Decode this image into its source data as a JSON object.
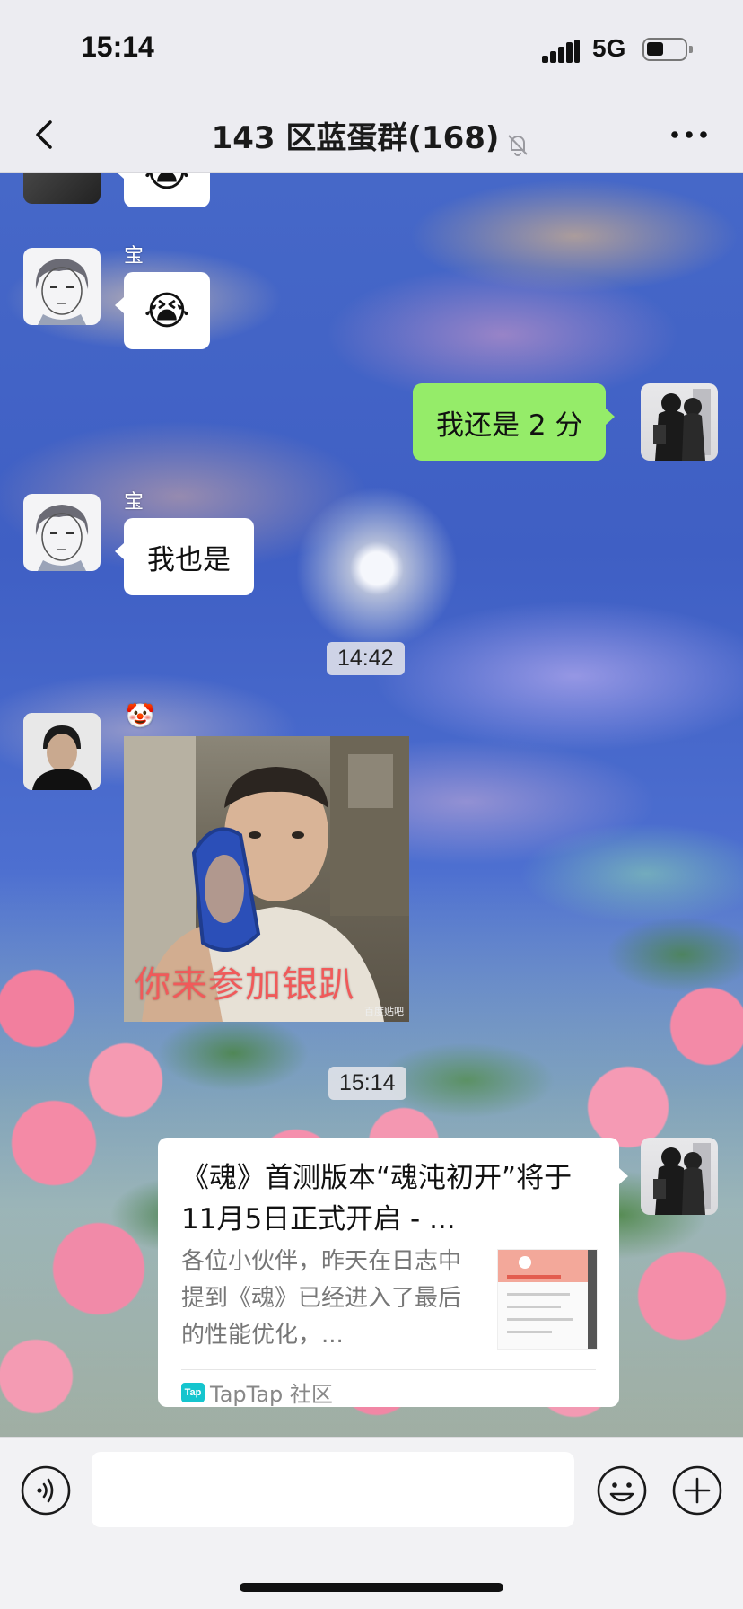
{
  "status_bar": {
    "time": "15:14",
    "network": "5G"
  },
  "nav": {
    "title": "143 区蓝蛋群(168)",
    "back_icon": "chevron-left-icon",
    "mute_icon": "bell-slash-icon",
    "more_icon": "ellipsis-icon"
  },
  "messages": [
    {
      "type": "emoji",
      "side": "left",
      "sender": "",
      "content": "😭"
    },
    {
      "type": "emoji",
      "side": "left",
      "sender": "宝",
      "content": "😭"
    },
    {
      "type": "text",
      "side": "right",
      "content": "我还是 2 分"
    },
    {
      "type": "text",
      "side": "left",
      "sender": "宝",
      "content": "我也是"
    },
    {
      "type": "time",
      "content": "14:42"
    },
    {
      "type": "image",
      "side": "left",
      "sender": "🤡",
      "caption": "你来参加银趴",
      "watermark": "百度贴吧"
    },
    {
      "type": "time",
      "content": "15:14"
    },
    {
      "type": "link_card",
      "side": "right",
      "title": "《魂》首测版本“魂沌初开”将于 11月5日正式开启 - ...",
      "description": "各位小伙伴，昨天在日志中提到《魂》已经进入了最后的性能优化，...",
      "source": "TapTap 社区",
      "source_logo": "Tap"
    }
  ],
  "input_bar": {
    "value": "",
    "voice_icon": "voice-icon",
    "emoji_icon": "smiley-icon",
    "plus_icon": "plus-circle-icon"
  },
  "colors": {
    "self_bubble": "#95ec69",
    "other_bubble": "#ffffff",
    "bar_background": "#ececf1"
  }
}
